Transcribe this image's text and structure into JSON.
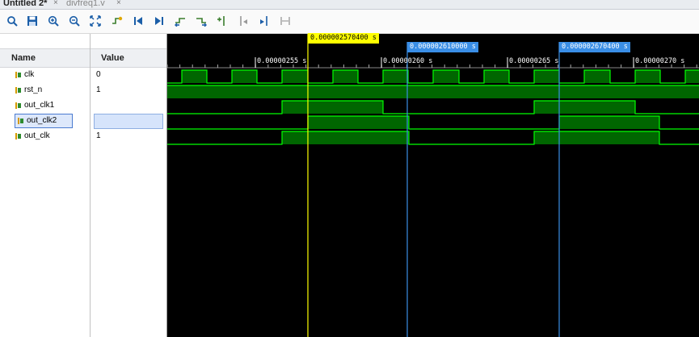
{
  "tabs": [
    {
      "label": "Untitled 2*",
      "active": true
    },
    {
      "label": "divfreq1.v",
      "active": false
    }
  ],
  "toolbar": {
    "icons": [
      "search-icon",
      "save-icon",
      "zoom-in-icon",
      "zoom-out-icon",
      "zoom-fit-icon",
      "go-to-cursor-icon",
      "go-to-start-icon",
      "go-to-end-icon",
      "previous-transition-icon",
      "next-transition-icon",
      "add-marker-icon",
      "previous-marker-icon",
      "next-marker-icon",
      "swap-cursors-icon"
    ]
  },
  "columns": {
    "name": "Name",
    "value": "Value"
  },
  "signals": [
    {
      "name": "clk",
      "value": "0",
      "selected": false
    },
    {
      "name": "rst_n",
      "value": "1",
      "selected": false
    },
    {
      "name": "out_clk1",
      "value": "",
      "selected": false
    },
    {
      "name": "out_clk2",
      "value": "",
      "selected": true
    },
    {
      "name": "out_clk",
      "value": "1",
      "selected": false
    }
  ],
  "time_ticks": [
    "0.00000255 s",
    "0.00000260 s",
    "0.00000265 s",
    "0.00000270 s"
  ],
  "cursors": {
    "main": "0.000002570400 s",
    "marker1": "0.000002610000 s",
    "marker2": "0.000002670400 s"
  },
  "colors": {
    "wave": "#00ff00",
    "wave_fill": "#006600",
    "main_cursor": "#ffff00",
    "marker": "#3a8ee6"
  }
}
